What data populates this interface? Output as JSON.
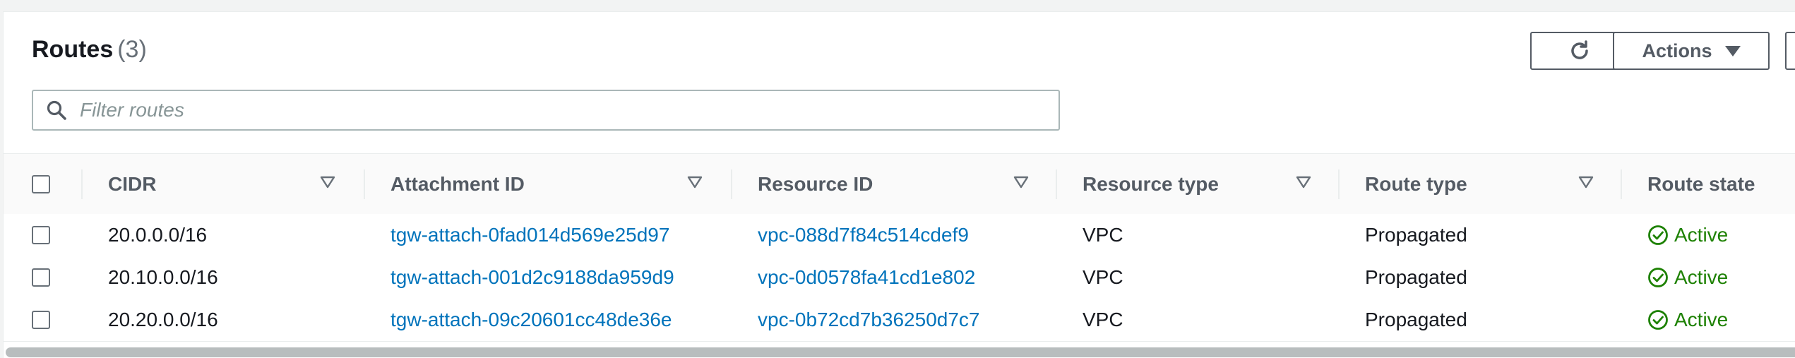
{
  "header": {
    "title": "Routes",
    "count": "(3)",
    "actions_label": "Actions",
    "refresh_icon": "refresh-icon"
  },
  "search": {
    "placeholder": "Filter routes",
    "value": ""
  },
  "table": {
    "columns": [
      {
        "label": "CIDR"
      },
      {
        "label": "Attachment ID"
      },
      {
        "label": "Resource ID"
      },
      {
        "label": "Resource type"
      },
      {
        "label": "Route type"
      },
      {
        "label": "Route state"
      }
    ],
    "rows": [
      {
        "cidr": "20.0.0.0/16",
        "attachment_id": "tgw-attach-0fad014d569e25d97",
        "resource_id": "vpc-088d7f84c514cdef9",
        "resource_type": "VPC",
        "route_type": "Propagated",
        "route_state": "Active"
      },
      {
        "cidr": "20.10.0.0/16",
        "attachment_id": "tgw-attach-001d2c9188da959d9",
        "resource_id": "vpc-0d0578fa41cd1e802",
        "resource_type": "VPC",
        "route_type": "Propagated",
        "route_state": "Active"
      },
      {
        "cidr": "20.20.0.0/16",
        "attachment_id": "tgw-attach-09c20601cc48de36e",
        "resource_id": "vpc-0b72cd7b36250d7c7",
        "resource_type": "VPC",
        "route_type": "Propagated",
        "route_state": "Active"
      }
    ]
  },
  "colors": {
    "link": "#0073bb",
    "status_active": "#1d8102",
    "header_text": "#545b64"
  }
}
